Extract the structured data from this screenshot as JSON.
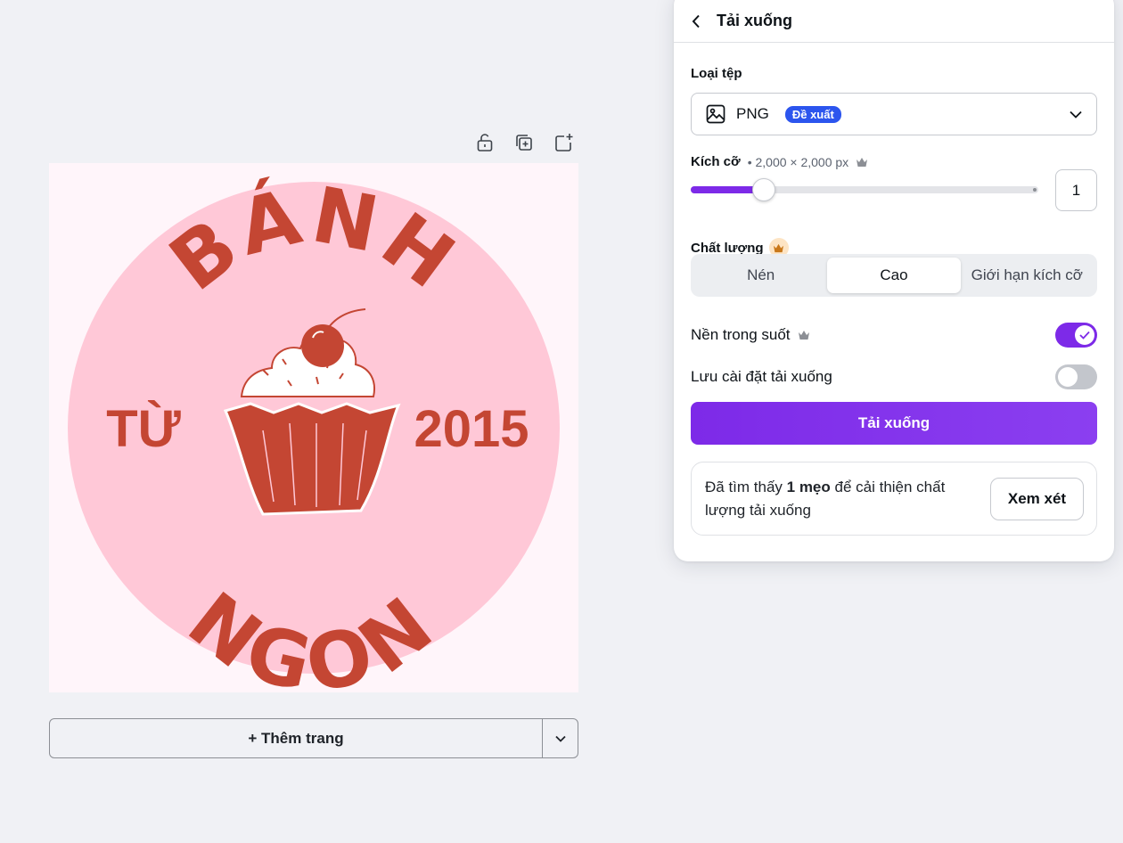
{
  "canvas": {
    "design": {
      "text_top": "BÁNH",
      "text_bottom": "NGON",
      "text_left": "TỪ",
      "text_right": "2015",
      "colors": {
        "circle": "#ffc8d7",
        "text": "#c44633",
        "background": "#fff5fa"
      }
    },
    "tools": {
      "lock_icon": "unlock-icon",
      "duplicate_icon": "duplicate-icon",
      "add_icon": "add-page-icon"
    },
    "add_page_label": "+ Thêm trang"
  },
  "panel": {
    "title": "Tải xuống",
    "file_type": {
      "label": "Loại tệp",
      "value": "PNG",
      "badge": "Đề xuất"
    },
    "size": {
      "label": "Kích cỡ",
      "detail": "• 2,000 × 2,000 px",
      "scale_value": "1",
      "slider_fraction": 0.21
    },
    "quality": {
      "label": "Chất lượng",
      "options": [
        "Nén",
        "Cao",
        "Giới hạn kích cỡ"
      ],
      "selected": "Cao"
    },
    "transparent_bg": {
      "label": "Nền trong suốt",
      "on": true
    },
    "save_settings": {
      "label": "Lưu cài đặt tải xuống",
      "on": false
    },
    "download_button": "Tải xuống",
    "tip": {
      "text_before": "Đã tìm thấy ",
      "text_bold": "1 mẹo",
      "text_after": " để cải thiện chất lượng tải xuống",
      "button": "Xem xét"
    },
    "accent_color": "#7d2ae8",
    "badge_color": "#2c55ee"
  }
}
